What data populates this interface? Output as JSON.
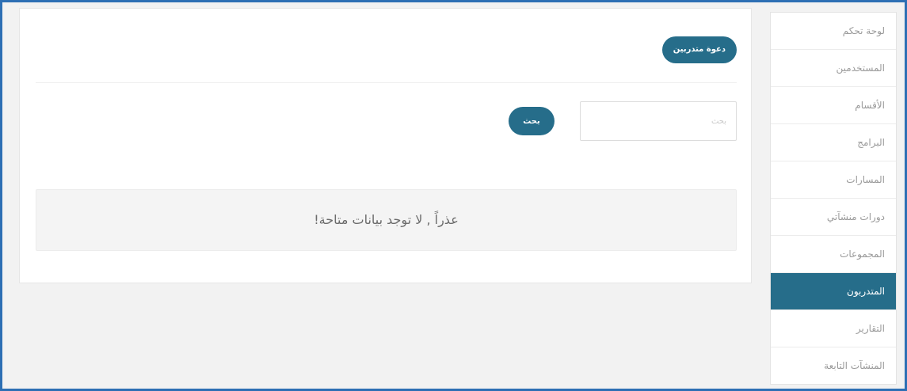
{
  "sidebar": {
    "items": [
      {
        "label": "لوحة تحكم",
        "active": false
      },
      {
        "label": "المستخدمين",
        "active": false
      },
      {
        "label": "الأقسام",
        "active": false
      },
      {
        "label": "البرامج",
        "active": false
      },
      {
        "label": "المسارات",
        "active": false
      },
      {
        "label": "دورات منشآتي",
        "active": false
      },
      {
        "label": "المجموعات",
        "active": false
      },
      {
        "label": "المتدربون",
        "active": true
      },
      {
        "label": "التقارير",
        "active": false
      },
      {
        "label": "المنشآت التابعة",
        "active": false
      }
    ]
  },
  "main": {
    "invite_button_label": "دعوة متدربين",
    "search": {
      "placeholder": "بحث",
      "value": "",
      "button_label": "بحث"
    },
    "empty_message": "عذراً , لا توجد بيانات متاحة!"
  },
  "colors": {
    "accent": "#266d8a",
    "frame_border": "#2d6fb4",
    "background": "#f2f2f2"
  }
}
